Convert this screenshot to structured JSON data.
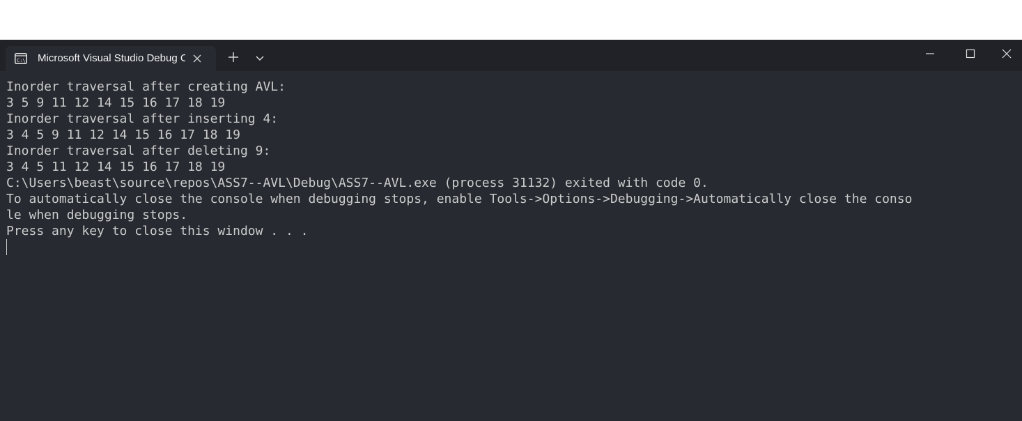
{
  "tab": {
    "title": "Microsoft Visual Studio Debug Console",
    "icon": "console-icon"
  },
  "titlebar": {
    "new_tab_icon": "plus-icon",
    "dropdown_icon": "chevron-down-icon",
    "minimize_icon": "minimize-icon",
    "maximize_icon": "maximize-icon",
    "close_icon": "close-icon"
  },
  "console": {
    "lines": [
      "Inorder traversal after creating AVL:",
      "3 5 9 11 12 14 15 16 17 18 19",
      "Inorder traversal after inserting 4:",
      "3 4 5 9 11 12 14 15 16 17 18 19",
      "Inorder traversal after deleting 9:",
      "3 4 5 11 12 14 15 16 17 18 19",
      "C:\\Users\\beast\\source\\repos\\ASS7--AVL\\Debug\\ASS7--AVL.exe (process 31132) exited with code 0.",
      "To automatically close the console when debugging stops, enable Tools->Options->Debugging->Automatically close the conso",
      "le when debugging stops.",
      "Press any key to close this window . . ."
    ]
  },
  "colors": {
    "console_background": "#272a31",
    "titlebar_background": "#202227",
    "text": "#cccccc"
  }
}
